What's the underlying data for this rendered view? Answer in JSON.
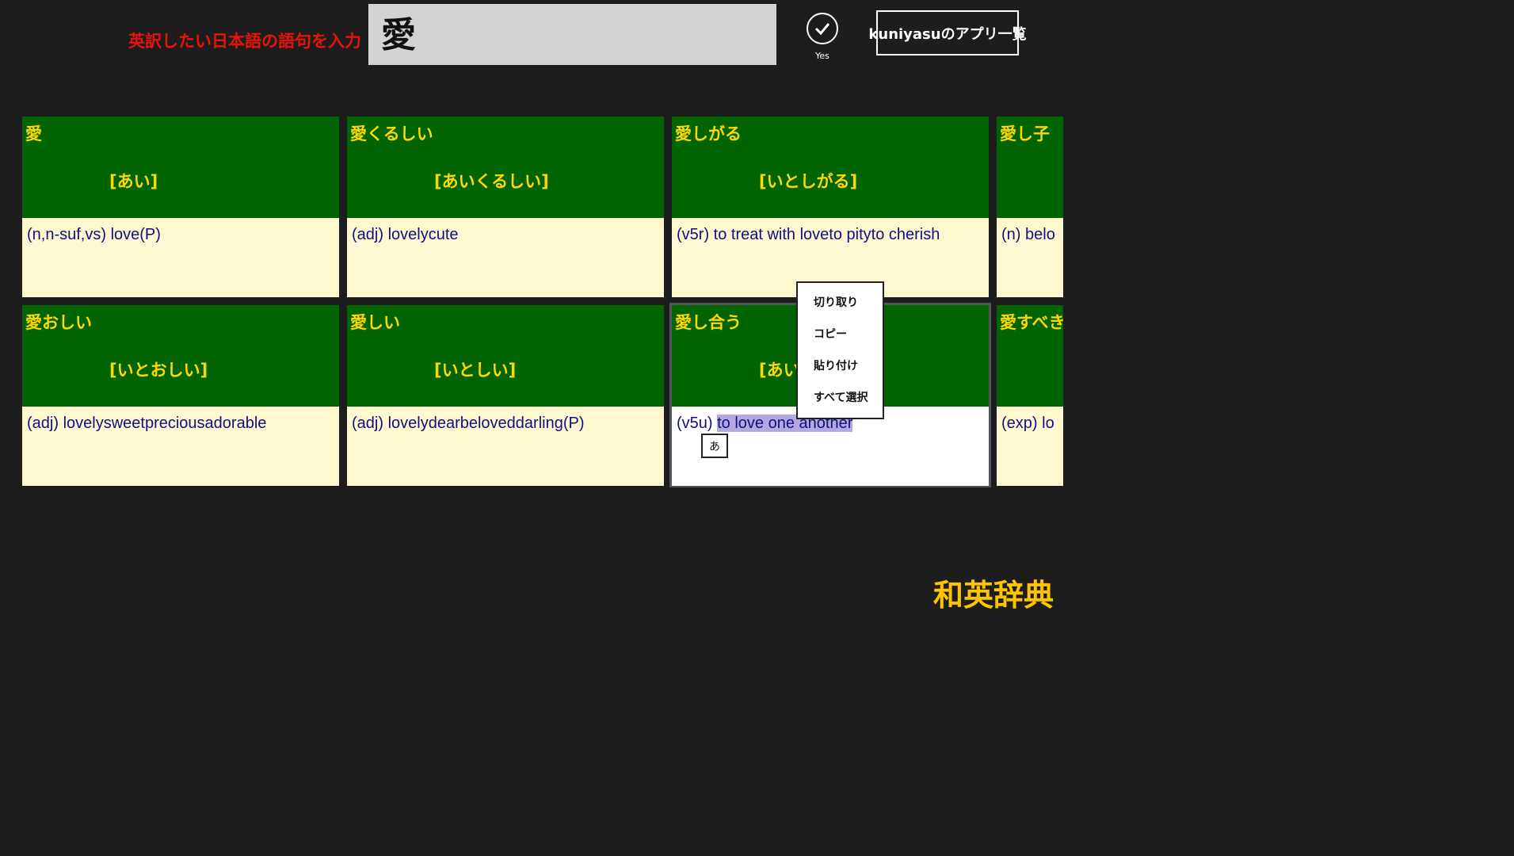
{
  "header": {
    "prompt_label": "英訳したい日本語の語句を入力",
    "search_value": "愛",
    "yes_label": "Yes",
    "apps_button_label": "kuniyasuのアプリ一覧"
  },
  "tiles": [
    {
      "word": "愛",
      "reading": "[あい]",
      "meaning": "(n,n-suf,vs) love(P)"
    },
    {
      "word": "愛くるしい",
      "reading": "[あいくるしい]",
      "meaning": "(adj) lovelycute"
    },
    {
      "word": "愛しがる",
      "reading": "[いとしがる]",
      "meaning": "(v5r) to treat with loveto pityto cherish"
    },
    {
      "word": "愛し子",
      "reading": "",
      "meaning": "(n) belo"
    },
    {
      "word": "愛おしい",
      "reading": "[いとおしい]",
      "meaning": "(adj) lovelysweetpreciousadorable"
    },
    {
      "word": "愛しい",
      "reading": "[いとしい]",
      "meaning": "(adj) lovelydearbeloveddarling(P)"
    },
    {
      "word": "愛し合う",
      "reading": "[あい",
      "meaning_prefix": "(v5u) ",
      "meaning_selected": "to love one another"
    },
    {
      "word": "愛すべき",
      "reading": "",
      "meaning": "(exp) lo"
    }
  ],
  "ime_indicator": "あ",
  "context_menu": {
    "cut": "切り取り",
    "copy": "コピー",
    "paste": "貼り付け",
    "select_all": "すべて選択"
  },
  "app_title": "和英辞典",
  "colors": {
    "background": "#1d1d1d",
    "tile_head": "#006400",
    "tile_text": "#ffd700",
    "tile_body": "#fff8d0",
    "prompt": "#e8120c",
    "app_title": "#ffc400"
  }
}
